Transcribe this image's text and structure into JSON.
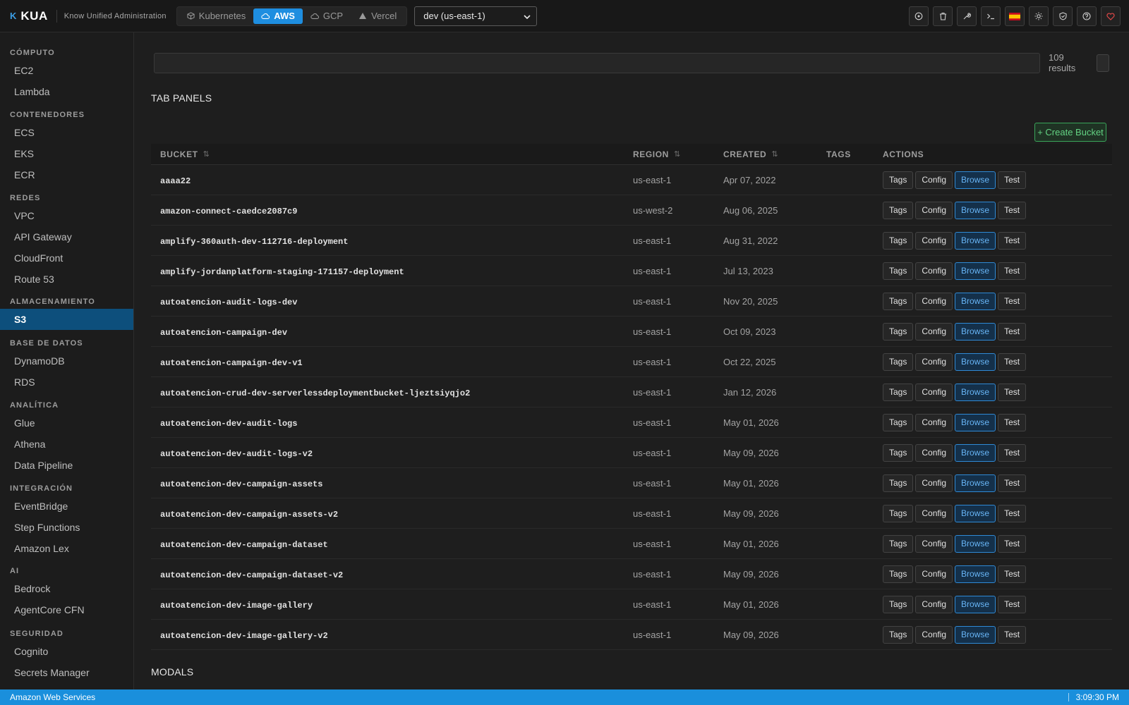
{
  "app": {
    "logo_mark": "K",
    "name": "KUA",
    "tagline": "Know Unified Administration"
  },
  "provider_tabs": [
    {
      "label": "Kubernetes",
      "icon": "cube-icon",
      "active": false
    },
    {
      "label": "AWS",
      "icon": "cloud-icon",
      "active": true
    },
    {
      "label": "GCP",
      "icon": "cloud-upload-icon",
      "active": false
    },
    {
      "label": "Vercel",
      "icon": "triangle-icon",
      "active": false
    }
  ],
  "environment": {
    "selected": "dev (us-east-1)"
  },
  "top_icons": [
    "target-icon",
    "trash-icon",
    "wrench-icon",
    "terminal-icon",
    "spain-flag-icon",
    "sun-icon",
    "shield-icon",
    "help-icon",
    "heart-icon"
  ],
  "sidebar": {
    "sections": [
      {
        "title": "CÓMPUTO",
        "items": [
          "EC2",
          "Lambda"
        ]
      },
      {
        "title": "CONTENEDORES",
        "items": [
          "ECS",
          "EKS",
          "ECR"
        ]
      },
      {
        "title": "REDES",
        "items": [
          "VPC",
          "API Gateway",
          "CloudFront",
          "Route 53"
        ]
      },
      {
        "title": "ALMACENAMIENTO",
        "items": [
          "S3"
        ]
      },
      {
        "title": "BASE DE DATOS",
        "items": [
          "DynamoDB",
          "RDS"
        ]
      },
      {
        "title": "ANALÍTICA",
        "items": [
          "Glue",
          "Athena",
          "Data Pipeline"
        ]
      },
      {
        "title": "INTEGRACIÓN",
        "items": [
          "EventBridge",
          "Step Functions",
          "Amazon Lex"
        ]
      },
      {
        "title": "AI",
        "items": [
          "Bedrock",
          "AgentCore CFN"
        ]
      },
      {
        "title": "SEGURIDAD",
        "items": [
          "Cognito",
          "Secrets Manager"
        ]
      }
    ],
    "active_item": "S3"
  },
  "main": {
    "search": {
      "value": "",
      "placeholder": ""
    },
    "results_count": "109",
    "results_label": "results",
    "tab_panels_title": "TAB PANELS",
    "modals_title": "MODALS",
    "create_button": "+ Create Bucket"
  },
  "table": {
    "columns": [
      "BUCKET",
      "REGION",
      "CREATED",
      "TAGS",
      "ACTIONS"
    ],
    "sort_glyph": "⇅",
    "action_labels": [
      "Tags",
      "Config",
      "Browse",
      "Test"
    ],
    "rows": [
      {
        "bucket": "aaaa22",
        "region": "us-east-1",
        "created": "Apr 07, 2022",
        "tags": ""
      },
      {
        "bucket": "amazon-connect-caedce2087c9",
        "region": "us-west-2",
        "created": "Aug 06, 2025",
        "tags": ""
      },
      {
        "bucket": "amplify-360auth-dev-112716-deployment",
        "region": "us-east-1",
        "created": "Aug 31, 2022",
        "tags": ""
      },
      {
        "bucket": "amplify-jordanplatform-staging-171157-deployment",
        "region": "us-east-1",
        "created": "Jul 13, 2023",
        "tags": ""
      },
      {
        "bucket": "autoatencion-audit-logs-dev",
        "region": "us-east-1",
        "created": "Nov 20, 2025",
        "tags": ""
      },
      {
        "bucket": "autoatencion-campaign-dev",
        "region": "us-east-1",
        "created": "Oct 09, 2023",
        "tags": ""
      },
      {
        "bucket": "autoatencion-campaign-dev-v1",
        "region": "us-east-1",
        "created": "Oct 22, 2025",
        "tags": ""
      },
      {
        "bucket": "autoatencion-crud-dev-serverlessdeploymentbucket-ljeztsiyqjo2",
        "region": "us-east-1",
        "created": "Jan 12, 2026",
        "tags": ""
      },
      {
        "bucket": "autoatencion-dev-audit-logs",
        "region": "us-east-1",
        "created": "May 01, 2026",
        "tags": ""
      },
      {
        "bucket": "autoatencion-dev-audit-logs-v2",
        "region": "us-east-1",
        "created": "May 09, 2026",
        "tags": ""
      },
      {
        "bucket": "autoatencion-dev-campaign-assets",
        "region": "us-east-1",
        "created": "May 01, 2026",
        "tags": ""
      },
      {
        "bucket": "autoatencion-dev-campaign-assets-v2",
        "region": "us-east-1",
        "created": "May 09, 2026",
        "tags": ""
      },
      {
        "bucket": "autoatencion-dev-campaign-dataset",
        "region": "us-east-1",
        "created": "May 01, 2026",
        "tags": ""
      },
      {
        "bucket": "autoatencion-dev-campaign-dataset-v2",
        "region": "us-east-1",
        "created": "May 09, 2026",
        "tags": ""
      },
      {
        "bucket": "autoatencion-dev-image-gallery",
        "region": "us-east-1",
        "created": "May 01, 2026",
        "tags": ""
      },
      {
        "bucket": "autoatencion-dev-image-gallery-v2",
        "region": "us-east-1",
        "created": "May 09, 2026",
        "tags": ""
      }
    ]
  },
  "statusbar": {
    "provider": "Amazon Web Services",
    "time": "3:09:30 PM"
  },
  "colors": {
    "accent": "#1a8fdc",
    "active_nav": "#0d4f7c",
    "create_green": "#3aa65a",
    "browse_blue": "#2f8ad6"
  }
}
